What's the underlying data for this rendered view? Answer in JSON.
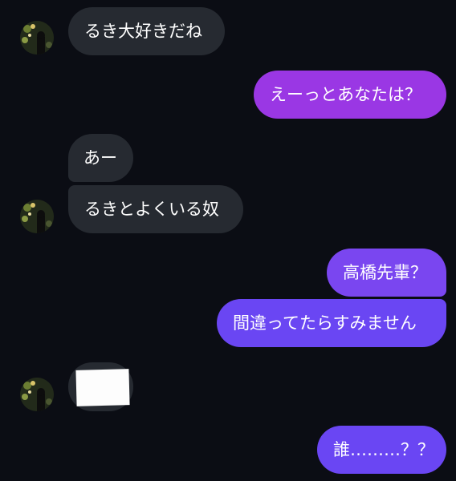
{
  "messages": [
    {
      "id": "m1",
      "direction": "received",
      "text": "るき大好きだね",
      "show_avatar": true
    },
    {
      "id": "m2",
      "direction": "sent",
      "text": "えーっとあなたは？"
    },
    {
      "id": "m3",
      "direction": "received",
      "text": "あー",
      "show_avatar": false
    },
    {
      "id": "m4",
      "direction": "received",
      "text": "るきとよくいる奴",
      "show_avatar": true
    },
    {
      "id": "m5",
      "direction": "sent",
      "text": "高橋先輩？"
    },
    {
      "id": "m6",
      "direction": "sent",
      "text": "間違ってたらすみません"
    },
    {
      "id": "m7",
      "direction": "received",
      "text": "",
      "content": "image-redacted",
      "show_avatar": true
    },
    {
      "id": "m8",
      "direction": "sent",
      "text": "誰………？？"
    }
  ],
  "colors": {
    "background": "#0b0d14",
    "received_bubble": "#262a31",
    "sent_gradient": [
      "#9a37e4",
      "#6a46f3"
    ],
    "text": "#ffffff"
  }
}
